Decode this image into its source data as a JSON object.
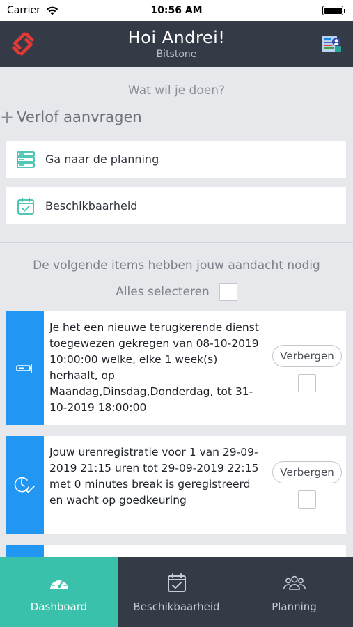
{
  "status_bar": {
    "carrier": "Carrier",
    "time": "10:56 AM",
    "battery_level": 1.0
  },
  "header": {
    "title": "Hoi Andrei!",
    "subtitle": "Bitstone",
    "logo_icon": "bitstone-logo-icon",
    "avatar_icon": "user-avatar-icon",
    "logo_color": "#e53935"
  },
  "actions": {
    "question": "Wat wil je doen?",
    "leave_request": {
      "plus": "+",
      "label": "Verlof aanvragen"
    },
    "items": [
      {
        "label": "Ga naar de planning",
        "icon": "server-list-icon"
      },
      {
        "label": "Beschikbaarheid",
        "icon": "calendar-check-icon"
      }
    ],
    "icon_color": "#39c1ac"
  },
  "attention": {
    "title": "De volgende items hebben jouw aandacht nodig",
    "select_all": "Alles selecteren"
  },
  "notifications": [
    {
      "text": "Je het een nieuwe terugkerende dienst toegewezen gekregen van 08-10-2019 10:00:00 welke, elke 1 week(s) herhaalt, op Maandag,Dinsdag,Donderdag, tot 31-10-2019 18:00:00",
      "hide_label": "Verbergen",
      "icon": "card-swipe-icon"
    },
    {
      "text": "Jouw urenregistratie voor 1 van 29-09-2019 21:15 uren tot 29-09-2019 22:15 met 0 minutes break is geregistreerd en wacht op goedkeuring",
      "hide_label": "Verbergen",
      "icon": "clock-check-icon"
    }
  ],
  "tabs": [
    {
      "label": "Dashboard",
      "icon": "speedometer-icon",
      "active": true
    },
    {
      "label": "Beschikbaarheid",
      "icon": "calendar-check-icon",
      "active": false
    },
    {
      "label": "Planning",
      "icon": "group-icon",
      "active": false
    }
  ],
  "colors": {
    "header_bg": "#343b47",
    "accent_teal": "#39c1ac",
    "notification_strip": "#2196f3"
  }
}
